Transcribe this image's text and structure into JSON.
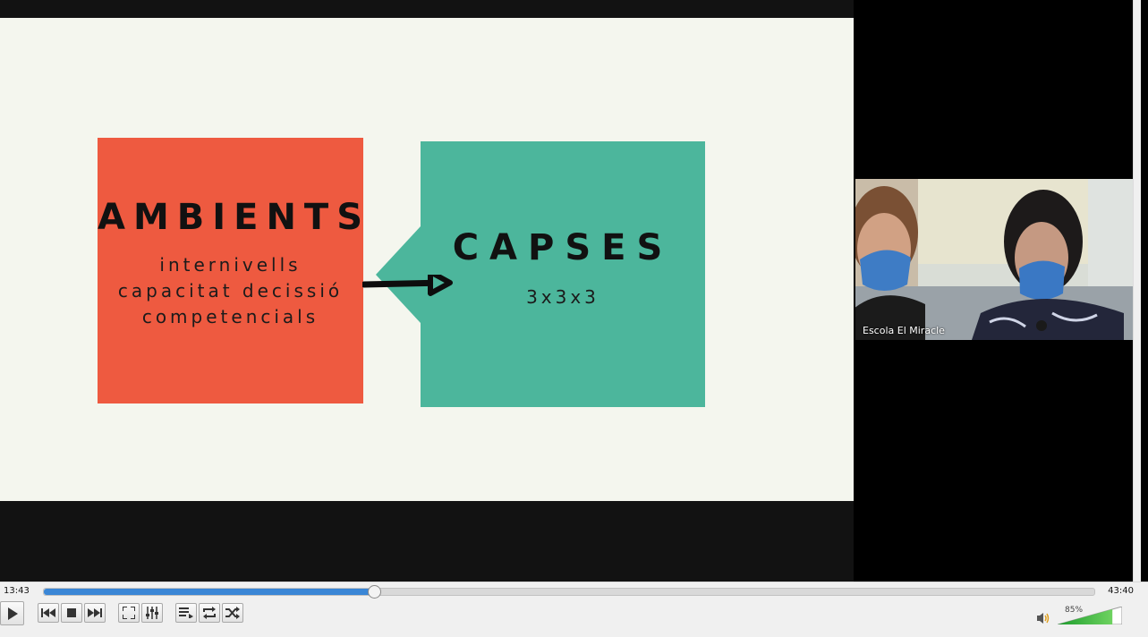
{
  "slide": {
    "left_title": "AMBIENTS",
    "left_lines": [
      "internivells",
      "capacitat decissió",
      "competencials"
    ],
    "right_title": "CAPSES",
    "right_sub": "3x3x3",
    "colors": {
      "left_box": "#ee5a40",
      "right_box": "#4cb69c",
      "background": "#f4f6ee"
    }
  },
  "participant": {
    "name": "Escola El Miracle"
  },
  "player": {
    "elapsed": "13:43",
    "total": "43:40",
    "progress_fraction": 0.314,
    "volume_label": "85%",
    "volume_fraction": 0.85,
    "accent": "#3a86d6",
    "buttons": [
      "play-icon",
      "previous-icon",
      "stop-icon",
      "next-icon",
      "fullscreen-icon",
      "extended-settings-icon",
      "playlist-icon",
      "loop-icon",
      "shuffle-icon"
    ]
  }
}
